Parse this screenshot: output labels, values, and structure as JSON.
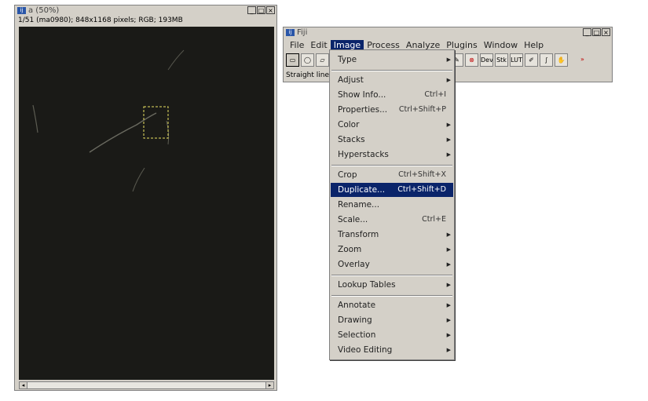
{
  "image_window": {
    "app_icon": "fiji-icon",
    "title": "a (50%)",
    "info": "1/51 (ma0980); 848x1168 pixels; RGB; 193MB",
    "buttons": [
      "_",
      "□",
      "×"
    ],
    "scroll_left": "◂",
    "scroll_right": "▸"
  },
  "fiji_window": {
    "app_icon": "fiji-icon",
    "title": "Fiji",
    "buttons": [
      "_",
      "□",
      "×"
    ],
    "menus": [
      "File",
      "Edit",
      "Image",
      "Process",
      "Analyze",
      "Plugins",
      "Window",
      "Help"
    ],
    "active_menu": "Image",
    "tools": [
      {
        "icon": "rectangle-icon",
        "glyph": "▭"
      },
      {
        "icon": "oval-icon",
        "glyph": "◯"
      },
      {
        "icon": "polygon-icon",
        "glyph": "▱"
      },
      {
        "icon": "color-picker-icon",
        "glyph": "✎"
      },
      {
        "icon": "close-circle-icon",
        "glyph": "⊗"
      },
      {
        "icon": "dev-icon",
        "glyph": "Dev"
      },
      {
        "icon": "stack-icon",
        "glyph": "Stk"
      },
      {
        "icon": "lut-icon",
        "glyph": "LUT"
      },
      {
        "icon": "pencil-icon",
        "glyph": "✐"
      },
      {
        "icon": "brush-icon",
        "glyph": "∫"
      },
      {
        "icon": "hand-icon",
        "glyph": "✋"
      },
      {
        "icon": "more-tools-icon",
        "glyph": "»"
      }
    ],
    "status": "Straight line s"
  },
  "image_menu": {
    "items": [
      {
        "label": "Type",
        "shortcut": "",
        "submenu": true
      },
      {
        "separator": true
      },
      {
        "label": "Adjust",
        "shortcut": "",
        "submenu": true
      },
      {
        "label": "Show Info...",
        "shortcut": "Ctrl+I",
        "submenu": false
      },
      {
        "label": "Properties...",
        "shortcut": "Ctrl+Shift+P",
        "submenu": false
      },
      {
        "label": "Color",
        "shortcut": "",
        "submenu": true
      },
      {
        "label": "Stacks",
        "shortcut": "",
        "submenu": true
      },
      {
        "label": "Hyperstacks",
        "shortcut": "",
        "submenu": true
      },
      {
        "separator": true
      },
      {
        "label": "Crop",
        "shortcut": "Ctrl+Shift+X",
        "submenu": false
      },
      {
        "label": "Duplicate...",
        "shortcut": "Ctrl+Shift+D",
        "submenu": false,
        "highlighted": true
      },
      {
        "label": "Rename...",
        "shortcut": "",
        "submenu": false
      },
      {
        "label": "Scale...",
        "shortcut": "Ctrl+E",
        "submenu": false
      },
      {
        "label": "Transform",
        "shortcut": "",
        "submenu": true
      },
      {
        "label": "Zoom",
        "shortcut": "",
        "submenu": true
      },
      {
        "label": "Overlay",
        "shortcut": "",
        "submenu": true
      },
      {
        "separator": true
      },
      {
        "label": "Lookup Tables",
        "shortcut": "",
        "submenu": true
      },
      {
        "separator": true
      },
      {
        "label": "Annotate",
        "shortcut": "",
        "submenu": true
      },
      {
        "label": "Drawing",
        "shortcut": "",
        "submenu": true
      },
      {
        "label": "Selection",
        "shortcut": "",
        "submenu": true
      },
      {
        "label": "Video Editing",
        "shortcut": "",
        "submenu": true
      }
    ]
  },
  "colors": {
    "highlight": "#0a246a",
    "window_bg": "#d4d0c8",
    "image_bg": "#1a1a17",
    "roi": "#e8e060"
  }
}
